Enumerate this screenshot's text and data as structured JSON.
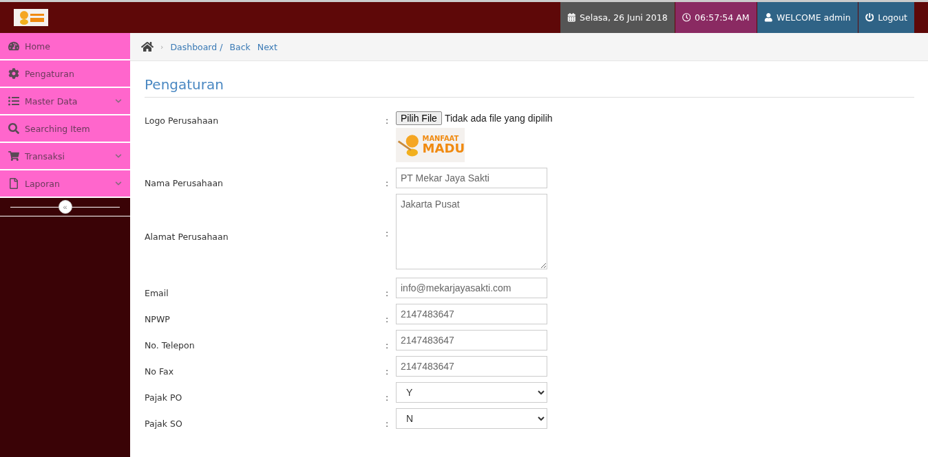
{
  "logo": {
    "line1": "MANFAAT",
    "line2": "MADU"
  },
  "header": {
    "date": "Selasa, 26 Juni 2018",
    "time": "06:57:54 AM",
    "welcome": "WELCOME admin",
    "logout": "Logout"
  },
  "sidebar": {
    "items": [
      {
        "label": "Home",
        "expandable": false
      },
      {
        "label": "Pengaturan",
        "expandable": false
      },
      {
        "label": "Master Data",
        "expandable": true
      },
      {
        "label": "Searching Item",
        "expandable": false
      },
      {
        "label": "Transaksi",
        "expandable": true
      },
      {
        "label": "Laporan",
        "expandable": true
      }
    ],
    "collapse": "«"
  },
  "breadcrumb": {
    "separator": "›",
    "items": [
      "Dashboard /",
      "Back",
      "Next"
    ]
  },
  "page_title": "Pengaturan",
  "form": {
    "fields": [
      {
        "kind": "file",
        "label": "Logo Perusahaan",
        "colon": ":",
        "button": "Pilih File",
        "status": "Tidak ada file yang dipilih"
      },
      {
        "kind": "text",
        "label": "Nama Perusahaan",
        "colon": ":",
        "value": "PT Mekar Jaya Sakti"
      },
      {
        "kind": "textarea",
        "label": "Alamat Perusahaan",
        "colon": ":",
        "value": "Jakarta Pusat"
      },
      {
        "kind": "text",
        "label": "Email",
        "colon": ":",
        "value": "info@mekarjayasakti.com"
      },
      {
        "kind": "text",
        "label": "NPWP",
        "colon": ":",
        "value": "2147483647"
      },
      {
        "kind": "text",
        "label": "No. Telepon",
        "colon": ":",
        "value": "2147483647"
      },
      {
        "kind": "text",
        "label": "No Fax",
        "colon": ":",
        "value": "2147483647"
      },
      {
        "kind": "select",
        "label": "Pajak PO",
        "colon": ":",
        "value": "Y"
      },
      {
        "kind": "select",
        "label": "Pajak SO",
        "colon": ":",
        "value": "N"
      }
    ]
  }
}
